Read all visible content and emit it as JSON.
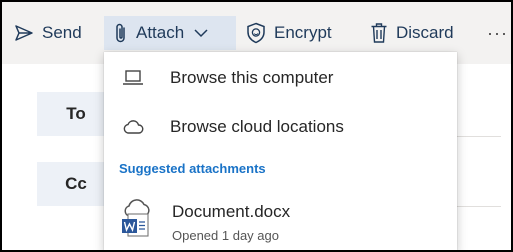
{
  "toolbar": {
    "send_label": "Send",
    "attach_label": "Attach",
    "encrypt_label": "Encrypt",
    "discard_label": "Discard",
    "more_label": "···"
  },
  "compose": {
    "to_label": "To",
    "cc_label": "Cc"
  },
  "attach_menu": {
    "items": [
      {
        "label": "Browse this computer",
        "icon": "laptop-icon"
      },
      {
        "label": "Browse cloud locations",
        "icon": "cloud-icon"
      }
    ],
    "section_label": "Suggested attachments",
    "suggested": [
      {
        "name": "Document.docx",
        "meta": "Opened 1 day ago",
        "icon": "word-cloud-doc-icon"
      }
    ]
  },
  "colors": {
    "toolbar_bg": "#f3f2f1",
    "attach_active_bg": "#dde5f0",
    "accent": "#1a73c7",
    "field_button_bg": "#edf1f7",
    "word_blue": "#2b579a"
  }
}
